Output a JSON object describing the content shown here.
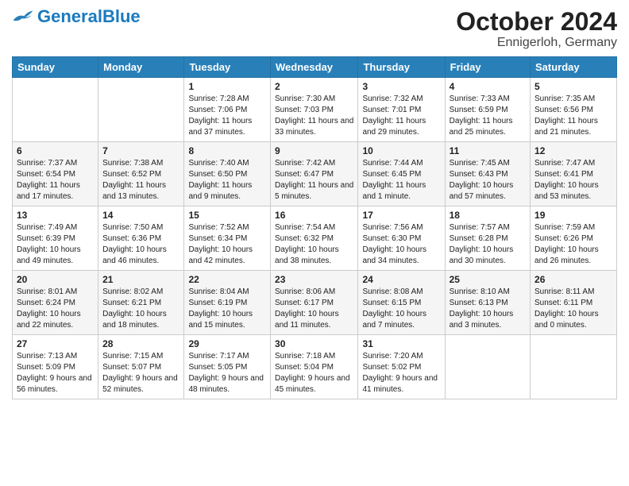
{
  "header": {
    "logo_general": "General",
    "logo_blue": "Blue",
    "title": "October 2024",
    "subtitle": "Ennigerloh, Germany"
  },
  "days_of_week": [
    "Sunday",
    "Monday",
    "Tuesday",
    "Wednesday",
    "Thursday",
    "Friday",
    "Saturday"
  ],
  "weeks": [
    [
      null,
      null,
      {
        "day": 1,
        "sunrise": "7:28 AM",
        "sunset": "7:06 PM",
        "daylight": "11 hours and 37 minutes."
      },
      {
        "day": 2,
        "sunrise": "7:30 AM",
        "sunset": "7:03 PM",
        "daylight": "11 hours and 33 minutes."
      },
      {
        "day": 3,
        "sunrise": "7:32 AM",
        "sunset": "7:01 PM",
        "daylight": "11 hours and 29 minutes."
      },
      {
        "day": 4,
        "sunrise": "7:33 AM",
        "sunset": "6:59 PM",
        "daylight": "11 hours and 25 minutes."
      },
      {
        "day": 5,
        "sunrise": "7:35 AM",
        "sunset": "6:56 PM",
        "daylight": "11 hours and 21 minutes."
      }
    ],
    [
      {
        "day": 6,
        "sunrise": "7:37 AM",
        "sunset": "6:54 PM",
        "daylight": "11 hours and 17 minutes."
      },
      {
        "day": 7,
        "sunrise": "7:38 AM",
        "sunset": "6:52 PM",
        "daylight": "11 hours and 13 minutes."
      },
      {
        "day": 8,
        "sunrise": "7:40 AM",
        "sunset": "6:50 PM",
        "daylight": "11 hours and 9 minutes."
      },
      {
        "day": 9,
        "sunrise": "7:42 AM",
        "sunset": "6:47 PM",
        "daylight": "11 hours and 5 minutes."
      },
      {
        "day": 10,
        "sunrise": "7:44 AM",
        "sunset": "6:45 PM",
        "daylight": "11 hours and 1 minute."
      },
      {
        "day": 11,
        "sunrise": "7:45 AM",
        "sunset": "6:43 PM",
        "daylight": "10 hours and 57 minutes."
      },
      {
        "day": 12,
        "sunrise": "7:47 AM",
        "sunset": "6:41 PM",
        "daylight": "10 hours and 53 minutes."
      }
    ],
    [
      {
        "day": 13,
        "sunrise": "7:49 AM",
        "sunset": "6:39 PM",
        "daylight": "10 hours and 49 minutes."
      },
      {
        "day": 14,
        "sunrise": "7:50 AM",
        "sunset": "6:36 PM",
        "daylight": "10 hours and 46 minutes."
      },
      {
        "day": 15,
        "sunrise": "7:52 AM",
        "sunset": "6:34 PM",
        "daylight": "10 hours and 42 minutes."
      },
      {
        "day": 16,
        "sunrise": "7:54 AM",
        "sunset": "6:32 PM",
        "daylight": "10 hours and 38 minutes."
      },
      {
        "day": 17,
        "sunrise": "7:56 AM",
        "sunset": "6:30 PM",
        "daylight": "10 hours and 34 minutes."
      },
      {
        "day": 18,
        "sunrise": "7:57 AM",
        "sunset": "6:28 PM",
        "daylight": "10 hours and 30 minutes."
      },
      {
        "day": 19,
        "sunrise": "7:59 AM",
        "sunset": "6:26 PM",
        "daylight": "10 hours and 26 minutes."
      }
    ],
    [
      {
        "day": 20,
        "sunrise": "8:01 AM",
        "sunset": "6:24 PM",
        "daylight": "10 hours and 22 minutes."
      },
      {
        "day": 21,
        "sunrise": "8:02 AM",
        "sunset": "6:21 PM",
        "daylight": "10 hours and 18 minutes."
      },
      {
        "day": 22,
        "sunrise": "8:04 AM",
        "sunset": "6:19 PM",
        "daylight": "10 hours and 15 minutes."
      },
      {
        "day": 23,
        "sunrise": "8:06 AM",
        "sunset": "6:17 PM",
        "daylight": "10 hours and 11 minutes."
      },
      {
        "day": 24,
        "sunrise": "8:08 AM",
        "sunset": "6:15 PM",
        "daylight": "10 hours and 7 minutes."
      },
      {
        "day": 25,
        "sunrise": "8:10 AM",
        "sunset": "6:13 PM",
        "daylight": "10 hours and 3 minutes."
      },
      {
        "day": 26,
        "sunrise": "8:11 AM",
        "sunset": "6:11 PM",
        "daylight": "10 hours and 0 minutes."
      }
    ],
    [
      {
        "day": 27,
        "sunrise": "7:13 AM",
        "sunset": "5:09 PM",
        "daylight": "9 hours and 56 minutes."
      },
      {
        "day": 28,
        "sunrise": "7:15 AM",
        "sunset": "5:07 PM",
        "daylight": "9 hours and 52 minutes."
      },
      {
        "day": 29,
        "sunrise": "7:17 AM",
        "sunset": "5:05 PM",
        "daylight": "9 hours and 48 minutes."
      },
      {
        "day": 30,
        "sunrise": "7:18 AM",
        "sunset": "5:04 PM",
        "daylight": "9 hours and 45 minutes."
      },
      {
        "day": 31,
        "sunrise": "7:20 AM",
        "sunset": "5:02 PM",
        "daylight": "9 hours and 41 minutes."
      },
      null,
      null
    ]
  ]
}
